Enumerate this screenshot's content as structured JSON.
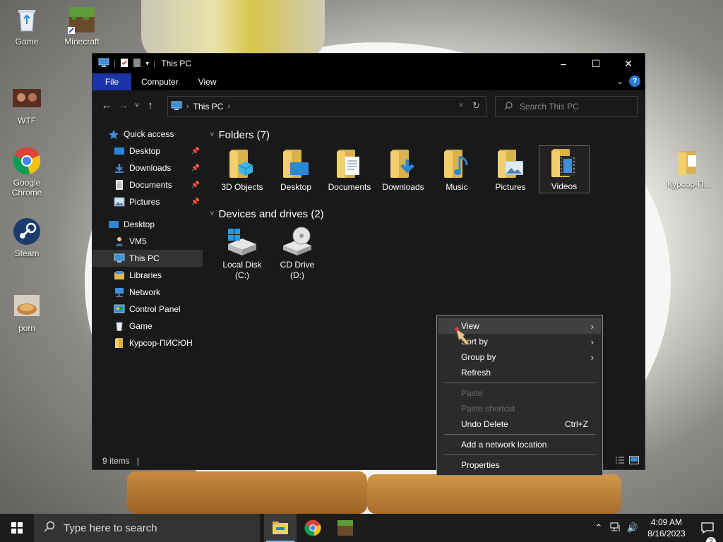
{
  "desktop": {
    "icons": [
      {
        "label": "Game"
      },
      {
        "label": "Minecraft"
      },
      {
        "label": "WTF"
      },
      {
        "label": "Google Chrome"
      },
      {
        "label": "Steam"
      },
      {
        "label": "porn"
      },
      {
        "label": "Курсор-П..."
      }
    ]
  },
  "window": {
    "title": "This PC",
    "ribbon_tabs": [
      {
        "label": "File"
      },
      {
        "label": "Computer"
      },
      {
        "label": "View"
      }
    ],
    "address": {
      "location": "This PC"
    },
    "search": {
      "placeholder": "Search This PC"
    }
  },
  "nav_pane": {
    "quick_access": "Quick access",
    "pinned": [
      {
        "label": "Desktop"
      },
      {
        "label": "Downloads"
      },
      {
        "label": "Documents"
      },
      {
        "label": "Pictures"
      }
    ],
    "tree": [
      {
        "label": "Desktop"
      },
      {
        "label": "VM5"
      },
      {
        "label": "This PC"
      },
      {
        "label": "Libraries"
      },
      {
        "label": "Network"
      },
      {
        "label": "Control Panel"
      },
      {
        "label": "Game"
      },
      {
        "label": "Курсор-ПИСЮН"
      }
    ]
  },
  "content": {
    "folders_header": "Folders (7)",
    "folders": [
      {
        "label": "3D Objects"
      },
      {
        "label": "Desktop"
      },
      {
        "label": "Documents"
      },
      {
        "label": "Downloads"
      },
      {
        "label": "Music"
      },
      {
        "label": "Pictures"
      },
      {
        "label": "Videos"
      }
    ],
    "devices_header": "Devices and drives (2)",
    "drives": [
      {
        "line1": "Local Disk",
        "line2": "(C:)"
      },
      {
        "line1": "CD Drive",
        "line2": "(D:)"
      }
    ]
  },
  "status": {
    "items": "9 items",
    "separator": "|"
  },
  "context_menu": {
    "view": "View",
    "sort_by": "Sort by",
    "group_by": "Group by",
    "refresh": "Refresh",
    "paste": "Paste",
    "paste_shortcut": "Paste shortcut",
    "undo_delete": "Undo Delete",
    "undo_shortcut": "Ctrl+Z",
    "add_network_location": "Add a network location",
    "properties": "Properties"
  },
  "taskbar": {
    "search_placeholder": "Type here to search",
    "time": "4:09 AM",
    "date": "8/16/2023",
    "notifications": "2"
  },
  "colors": {
    "accent": "#1a34a8",
    "folder": "#f1cf6a",
    "window_bg": "#191919"
  }
}
